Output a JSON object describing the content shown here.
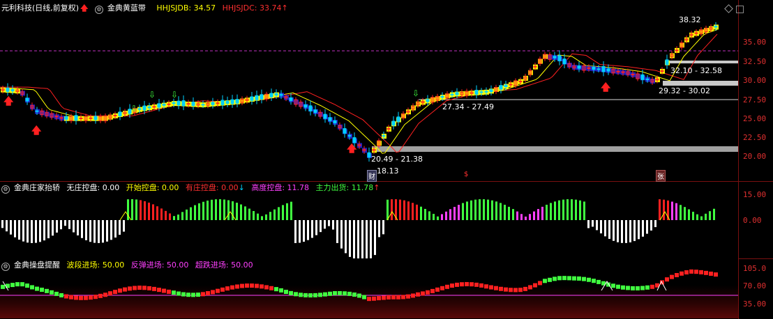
{
  "panel1": {
    "stock_name": "元利科技(日线,前复权)",
    "indicator": "金典黄蓝带",
    "hhjsjdb_label": "HHJSJDB: 34.57",
    "hhjsjdc_label": "HHJSJDC: 33.74",
    "y_ticks": [
      "35.00",
      "32.50",
      "30.00",
      "27.50",
      "25.00",
      "22.50",
      "20.00"
    ],
    "price_labels": {
      "high": "38.32",
      "r1": "32.10 - 32.58",
      "r2": "29.32 - 30.02",
      "r3": "27.34 - 27.49",
      "r4": "20.49 - 21.38",
      "low": "18.13"
    },
    "markers": {
      "cai": "财",
      "s": "$",
      "zhang": "张"
    }
  },
  "panel2": {
    "indicator": "金典庄家抬轿",
    "wzkp": "无庄控盘: 0.00",
    "kskp": "开始控盘: 0.00",
    "yzkp": "有庄控盘: 0.00",
    "gdkp": "高度控盘: 11.78",
    "zlch": "主力出货: 11.78",
    "y_ticks": [
      "15.00",
      "0.00"
    ]
  },
  "panel3": {
    "indicator": "金典操盘提醒",
    "bdjc": "波段进场: 50.00",
    "ftjc": "反弹进场: 50.00",
    "cdjc": "超跌进场: 50.00",
    "y_ticks": [
      "105.0",
      "70.00",
      "35.00"
    ]
  },
  "colors": {
    "up": "#ff2020",
    "down": "#00d0ff",
    "yellow": "#ffff00",
    "blue": "#2020c0",
    "magenta": "#ff40ff",
    "green": "#40ff40",
    "white": "#ffffff",
    "gray": "#a0a0a0"
  },
  "icons": [
    "gear-icon",
    "arrow-up-icon",
    "diamond-icon",
    "window-icon"
  ]
}
